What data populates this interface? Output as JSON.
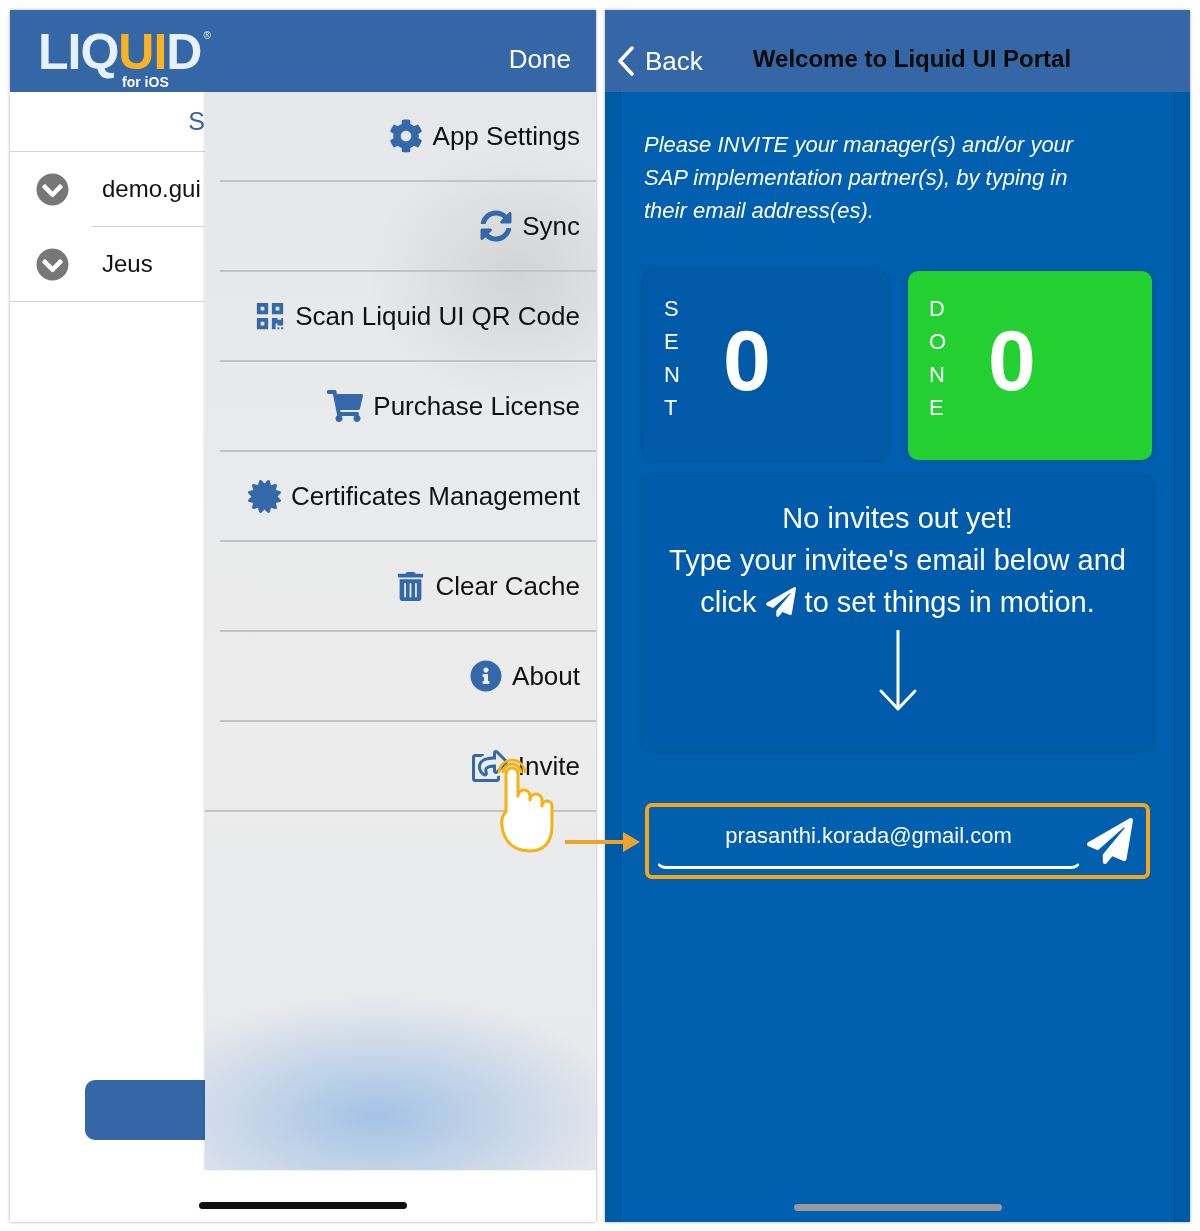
{
  "left_screen": {
    "header": {
      "logo": {
        "parts": [
          {
            "text": "LIQ",
            "accent": false
          },
          {
            "text": "UI",
            "accent": true
          },
          {
            "text": "D",
            "accent": false
          }
        ],
        "mark": "®",
        "subtitle": "for iOS"
      },
      "done_button": "Done"
    },
    "list": {
      "header": "S",
      "rows": [
        {
          "label": "demo.gui"
        },
        {
          "label": "Jeus"
        }
      ]
    },
    "menu": {
      "items": [
        {
          "label": "App Settings",
          "tapped": false
        },
        {
          "label": "Sync",
          "tapped": false
        },
        {
          "label": "Scan Liquid UI QR Code",
          "tapped": false
        },
        {
          "label": "Purchase License",
          "tapped": false
        },
        {
          "label": "Certificates Management",
          "tapped": false
        },
        {
          "label": "Clear Cache",
          "tapped": false
        },
        {
          "label": "About",
          "tapped": false
        },
        {
          "label": "Invite",
          "tapped": true
        }
      ]
    }
  },
  "right_screen": {
    "header": {
      "back_button": "Back",
      "title": "Welcome to Liquid UI Portal"
    },
    "intro": "Please INVITE your manager(s) and/or your SAP implementation partner(s), by typing in their email address(es).",
    "stats": [
      {
        "label": "SENT",
        "value": "0",
        "color": "#005aa7"
      },
      {
        "label": "DONE",
        "value": "0",
        "color": "#24cf31"
      }
    ],
    "message": {
      "heading": "No invites out yet!",
      "line": "Type your invitee's email below and",
      "action_before": "click",
      "action_after": "to set things in motion."
    },
    "invite_form": {
      "email": "prasanthi.korada@gmail.com",
      "highlighted": true
    }
  }
}
